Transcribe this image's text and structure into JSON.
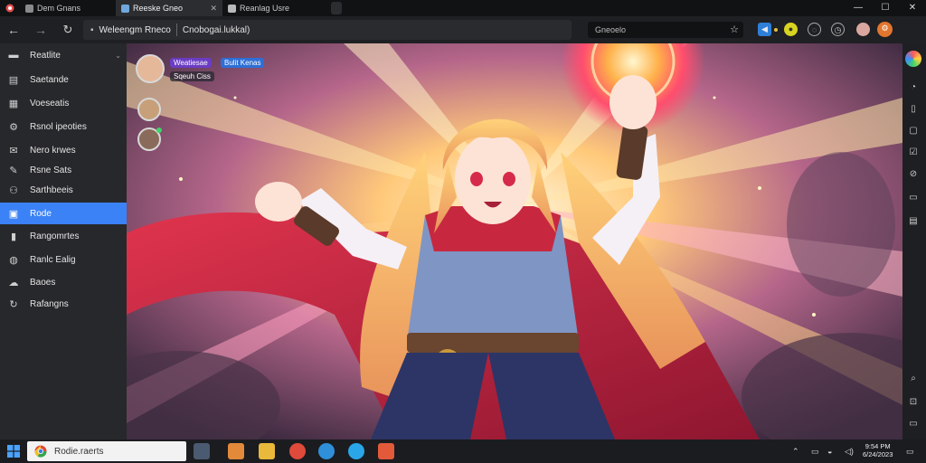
{
  "tabs": [
    {
      "label": "Dem Gnans",
      "active": false
    },
    {
      "label": "Reeske Gneo",
      "active": true
    },
    {
      "label": "Reanlag Usre",
      "active": false
    }
  ],
  "window_controls": {
    "minimize": "—",
    "maximize": "☐",
    "close": "✕"
  },
  "toolbar": {
    "address_site": "Weleengm Rneco",
    "address_path": "Cnobogai.lukkal)",
    "search_text": "Gneoelo"
  },
  "sidebar": {
    "items": [
      {
        "label": "Reatlite",
        "icon": "monitor-icon",
        "glyph": "▬"
      },
      {
        "label": "Saetande",
        "icon": "list-icon",
        "glyph": "▤"
      },
      {
        "label": "Voeseatis",
        "icon": "grid-icon",
        "glyph": "▦"
      },
      {
        "label": "Rsnol ipeoties",
        "icon": "gear-icon",
        "glyph": "⚙"
      },
      {
        "label": "Nero krwes",
        "icon": "chat-icon",
        "glyph": "✉"
      },
      {
        "label": "Rsne Sats",
        "icon": "pen-icon",
        "glyph": "✎"
      },
      {
        "label": "Sarthbeeis",
        "icon": "people-icon",
        "glyph": "⚇"
      },
      {
        "label": "Rode",
        "icon": "bookmark-icon",
        "glyph": "▣",
        "active": true
      },
      {
        "label": "Rangomrtes",
        "icon": "book-icon",
        "glyph": "▮"
      },
      {
        "label": "Ranlc Ealig",
        "icon": "globe-icon",
        "glyph": "◍"
      },
      {
        "label": "Baoes",
        "icon": "cloud-icon",
        "glyph": "☁"
      },
      {
        "label": "Rafangns",
        "icon": "refresh-icon",
        "glyph": "↻"
      }
    ]
  },
  "overlay": {
    "profile_name": "Weatiesae",
    "profile_badge": "Bulit Kenas",
    "profile_sub": "Sqeuh Ciss"
  },
  "taskbar": {
    "search_text": "Rodie.raerts",
    "time": "9:54 PM",
    "date": "6/24/2023"
  },
  "colors": {
    "accent": "#3b82f6",
    "cape": "#c7283f",
    "hair": "#f2b35c"
  }
}
